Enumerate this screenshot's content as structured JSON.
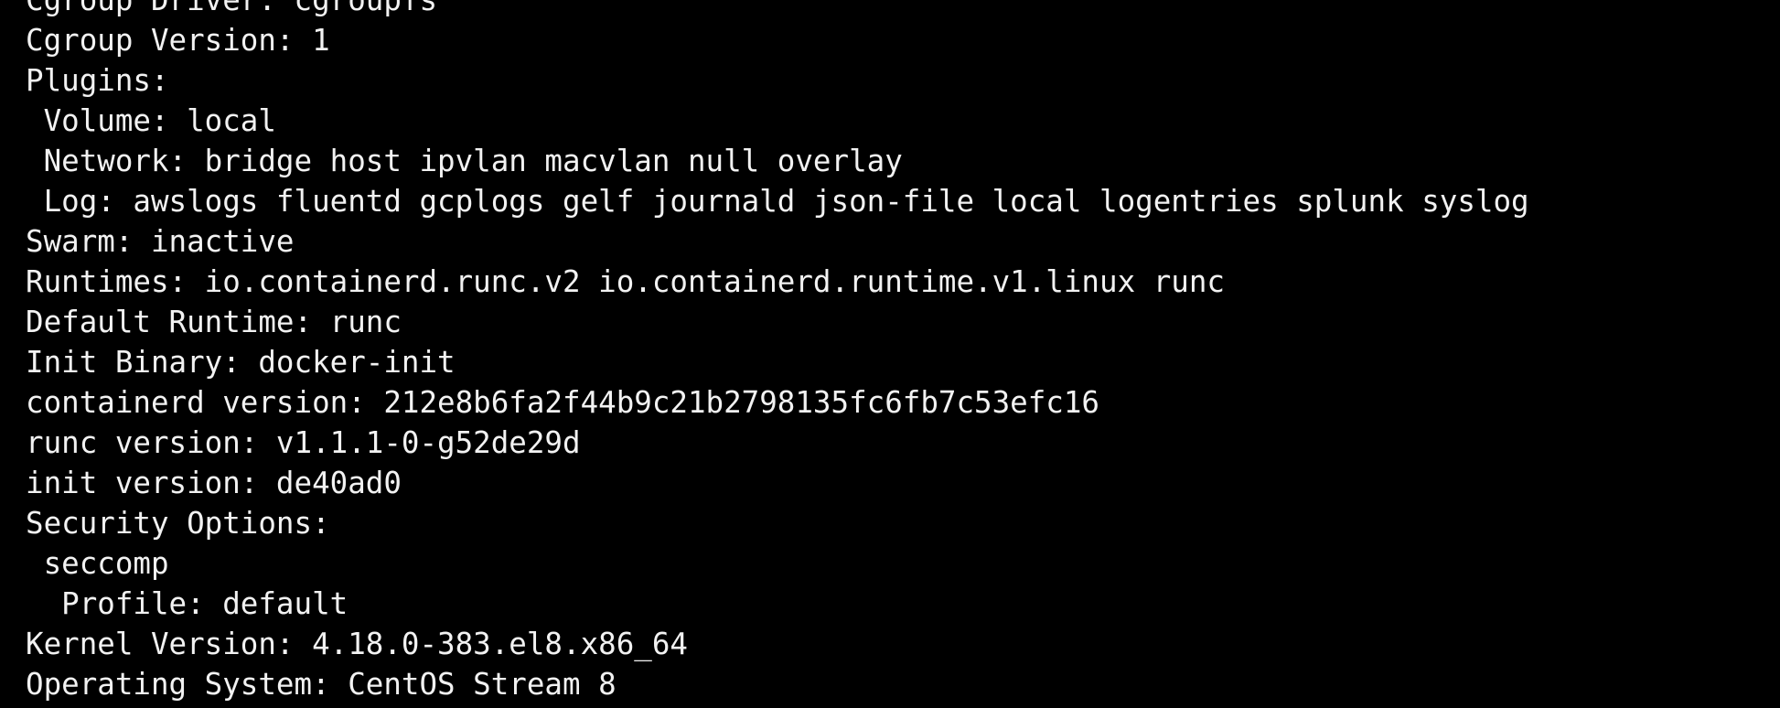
{
  "terminal": {
    "background": "#000000",
    "foreground": "#f2f2f2",
    "lines": [
      "Cgroup Driver: cgroupfs",
      "Cgroup Version: 1",
      "Plugins:",
      " Volume: local",
      " Network: bridge host ipvlan macvlan null overlay",
      " Log: awslogs fluentd gcplogs gelf journald json-file local logentries splunk syslog",
      "Swarm: inactive",
      "Runtimes: io.containerd.runc.v2 io.containerd.runtime.v1.linux runc",
      "Default Runtime: runc",
      "Init Binary: docker-init",
      "containerd version: 212e8b6fa2f44b9c21b2798135fc6fb7c53efc16",
      "runc version: v1.1.1-0-g52de29d",
      "init version: de40ad0",
      "Security Options:",
      " seccomp",
      "  Profile: default",
      "Kernel Version: 4.18.0-383.el8.x86_64",
      "Operating System: CentOS Stream 8"
    ]
  }
}
